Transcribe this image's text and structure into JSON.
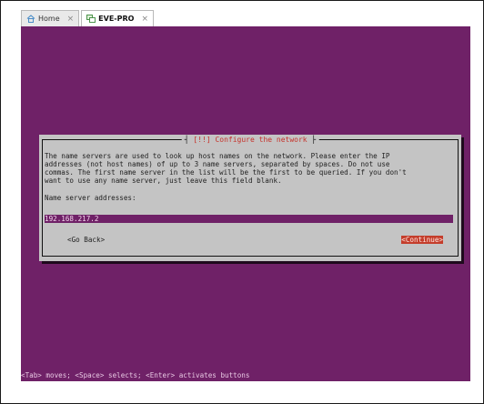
{
  "tabs": [
    {
      "label": "Home",
      "close": "×"
    },
    {
      "label": "EVE-PRO",
      "close": "×"
    }
  ],
  "dialog": {
    "title": "[!!] Configure the network",
    "description": "The name servers are used to look up host names on the network. Please enter the IP\naddresses (not host names) of up to 3 name servers, separated by spaces. Do not use\ncommas. The first name server in the list will be the first to be queried. If you don't\nwant to use any name server, just leave this field blank.",
    "field_label": "Name server addresses:",
    "field_value": "192.168.217.2",
    "back_button": "<Go Back>",
    "continue_button": "<Continue>"
  },
  "helpline": "<Tab> moves; <Space> selects; <Enter> activates buttons",
  "colors": {
    "background": "#6f2167",
    "dialog": "#c4c4c4",
    "title_text": "#c6322a",
    "continue_button": "#c43d2b"
  },
  "icons": {
    "home_tab": "house-icon",
    "vm_tab": "vm-icon"
  }
}
